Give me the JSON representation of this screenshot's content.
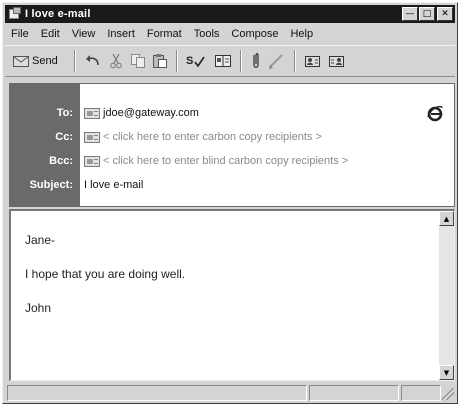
{
  "window": {
    "title": "I love e-mail"
  },
  "menu": [
    "File",
    "Edit",
    "View",
    "Insert",
    "Format",
    "Tools",
    "Compose",
    "Help"
  ],
  "toolbar": {
    "send_label": "Send",
    "icons": [
      "send-icon",
      "undo-icon",
      "cut-icon",
      "copy-icon",
      "paste-icon",
      "spelling-icon",
      "address-book-icon",
      "attach-icon",
      "signature-icon",
      "check-names-icon",
      "select-recipients-icon"
    ]
  },
  "header": {
    "to_label": "To:",
    "to_value": "jdoe@gateway.com",
    "cc_label": "Cc:",
    "cc_hint": "< click here to enter carbon copy recipients >",
    "bcc_label": "Bcc:",
    "bcc_hint": "< click here to enter blind carbon copy recipients >",
    "subject_label": "Subject:",
    "subject_value": "I love e-mail"
  },
  "body": {
    "lines": [
      "Jane-",
      "I hope that you are doing well.",
      "John"
    ]
  }
}
